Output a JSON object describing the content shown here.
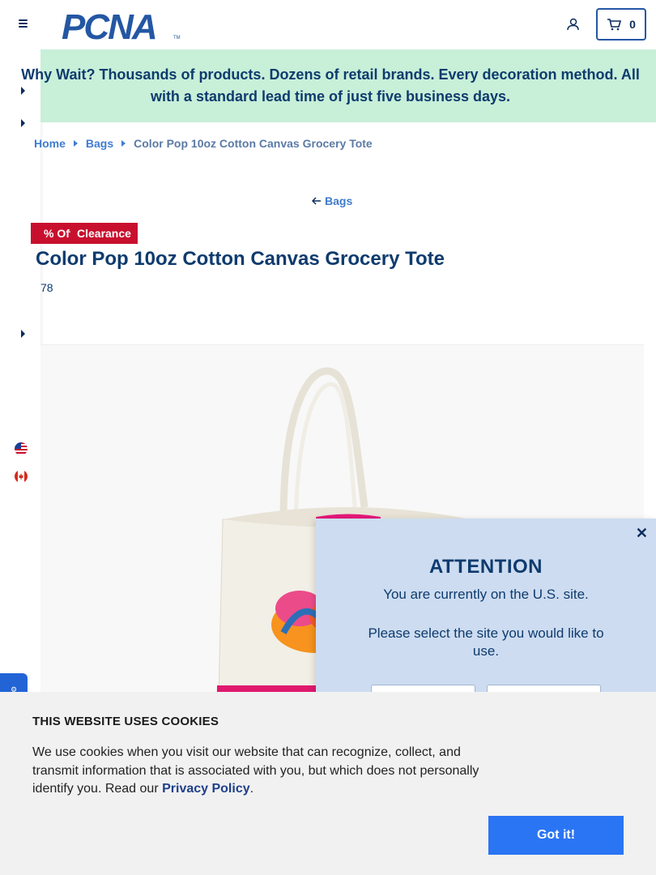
{
  "header": {
    "logo_text": "PCNA",
    "cart_count": "0"
  },
  "promo": {
    "text": "Why Wait? Thousands of products. Dozens of retail brands. Every decoration method. All with a standard lead time of just five business days."
  },
  "breadcrumb": {
    "items": [
      "Home",
      "Bags"
    ],
    "current": "Color Pop 10oz Cotton Canvas Grocery Tote"
  },
  "back_link": "Bags",
  "badges": {
    "discount": "% Off",
    "clearance": "Clearance"
  },
  "product": {
    "title": "Color Pop 10oz Cotton Canvas Grocery Tote",
    "sku": "78"
  },
  "attention": {
    "title": "ATTENTION",
    "line1": "You are currently on the U.S. site.",
    "line2": "Please select the site you would like to use."
  },
  "cookies": {
    "title": "THIS WEBSITE USES COOKIES",
    "text": "We use cookies when you visit our website that can recognize, collect, and transmit information that is associated with you, but which does not personally identify you. Read our ",
    "link": "Privacy Policy",
    "end": ".",
    "button": "Got it!"
  },
  "colors": {
    "brand_blue": "#0b2c5c",
    "promo_bg": "#c8efd8",
    "badge_red": "#c8102e",
    "button_blue": "#2a75f3"
  },
  "icons": [
    "menu-icon",
    "user-icon",
    "cart-icon",
    "us-flag-icon",
    "canada-flag-icon",
    "close-icon",
    "arrow-left-icon"
  ]
}
